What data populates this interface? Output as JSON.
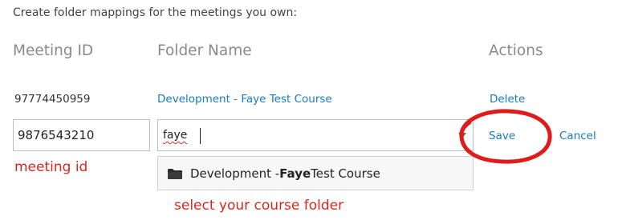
{
  "intro_text": "Create folder mappings for the meetings you own:",
  "table": {
    "headers": {
      "meeting_id": "Meeting ID",
      "folder_name": "Folder Name",
      "actions": "Actions"
    },
    "rows": [
      {
        "meeting_id": "97774450959",
        "folder_name": "Development - Faye Test Course",
        "delete_label": "Delete"
      }
    ]
  },
  "edit_row": {
    "meeting_id_value": "9876543210",
    "folder_search_value": "faye",
    "save_label": "Save",
    "cancel_label": "Cancel"
  },
  "suggestion": {
    "prefix": "Development - ",
    "match": "Faye",
    "suffix": " Test Course",
    "icon": "folder-icon"
  },
  "annotations": {
    "meeting_id_note": "meeting id",
    "folder_note": "select your course folder",
    "highlight_color": "#d6281f"
  },
  "colors": {
    "link": "#1a7bbf",
    "header": "#8a8a8a"
  }
}
